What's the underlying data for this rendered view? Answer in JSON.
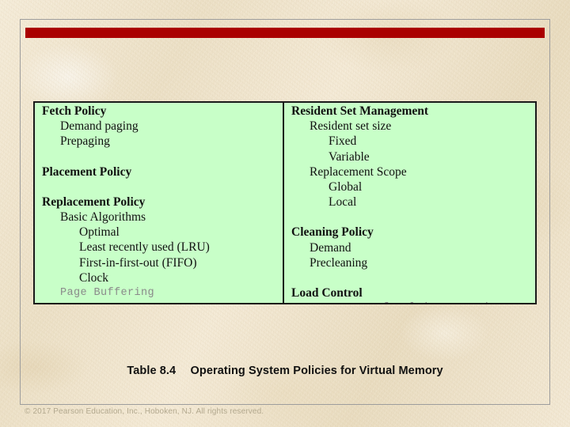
{
  "slide": {
    "accent_bar_color": "#aa0000",
    "background_color": "#f1e7d0",
    "frame_color": "#9d9d9d"
  },
  "table": {
    "background_color": "#c8ffc8",
    "border_color": "#1a1a1a",
    "columns": [
      {
        "name": "left-column",
        "entries": [
          {
            "text": "Fetch Policy",
            "level": 0,
            "style": "head"
          },
          {
            "text": "Demand paging",
            "level": 1,
            "style": "normal"
          },
          {
            "text": "Prepaging",
            "level": 1,
            "style": "normal"
          },
          {
            "text": "",
            "level": 0,
            "style": "spacer"
          },
          {
            "text": "Placement Policy",
            "level": 0,
            "style": "head"
          },
          {
            "text": "",
            "level": 0,
            "style": "spacer"
          },
          {
            "text": "Replacement Policy",
            "level": 0,
            "style": "head"
          },
          {
            "text": "Basic Algorithms",
            "level": 1,
            "style": "normal"
          },
          {
            "text": "Optimal",
            "level": 2,
            "style": "normal"
          },
          {
            "text": "Least recently used (LRU)",
            "level": 2,
            "style": "normal"
          },
          {
            "text": "First-in-first-out (FIFO)",
            "level": 2,
            "style": "normal"
          },
          {
            "text": "Clock",
            "level": 2,
            "style": "normal"
          },
          {
            "text": "Page Buffering",
            "level": 1,
            "style": "mono"
          }
        ]
      },
      {
        "name": "right-column",
        "entries": [
          {
            "text": "Resident Set Management",
            "level": 0,
            "style": "head"
          },
          {
            "text": "Resident set size",
            "level": 1,
            "style": "normal"
          },
          {
            "text": "Fixed",
            "level": 2,
            "style": "normal"
          },
          {
            "text": "Variable",
            "level": 2,
            "style": "normal"
          },
          {
            "text": "Replacement Scope",
            "level": 1,
            "style": "normal"
          },
          {
            "text": "Global",
            "level": 2,
            "style": "normal"
          },
          {
            "text": "Local",
            "level": 2,
            "style": "normal"
          },
          {
            "text": "",
            "level": 0,
            "style": "spacer"
          },
          {
            "text": "Cleaning Policy",
            "level": 0,
            "style": "head"
          },
          {
            "text": "Demand",
            "level": 1,
            "style": "normal"
          },
          {
            "text": "Precleaning",
            "level": 1,
            "style": "normal"
          },
          {
            "text": "",
            "level": 0,
            "style": "spacer"
          },
          {
            "text": "Load Control",
            "level": 0,
            "style": "head"
          },
          {
            "text": "Degree of multiprogramming",
            "level": 2,
            "style": "mono"
          }
        ]
      }
    ]
  },
  "caption": {
    "label": "Table 8.4",
    "title": "Operating System Policies for Virtual Memory"
  },
  "footer": {
    "copyright": "© 2017 Pearson Education, Inc., Hoboken, NJ. All rights reserved."
  }
}
